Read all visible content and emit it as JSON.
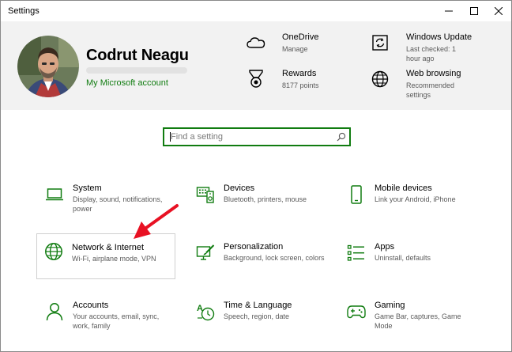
{
  "window": {
    "title": "Settings"
  },
  "header": {
    "user_name": "Codrut Neagu",
    "account_link": "My Microsoft account",
    "items": [
      {
        "title": "OneDrive",
        "subtitle": "Manage",
        "icon": "cloud-icon"
      },
      {
        "title": "Rewards",
        "subtitle": "8177 points",
        "icon": "medal-icon"
      },
      {
        "title": "Windows Update",
        "subtitle": "Last checked: 1 hour ago",
        "icon": "sync-icon"
      },
      {
        "title": "Web browsing",
        "subtitle": "Recommended settings",
        "icon": "globe-icon"
      }
    ]
  },
  "search": {
    "placeholder": "Find a setting",
    "value": ""
  },
  "categories": [
    {
      "title": "System",
      "subtitle": "Display, sound, notifications, power",
      "icon": "laptop-icon"
    },
    {
      "title": "Devices",
      "subtitle": "Bluetooth, printers, mouse",
      "icon": "keyboard-speaker-icon"
    },
    {
      "title": "Mobile devices",
      "subtitle": "Link your Android, iPhone",
      "icon": "phone-icon"
    },
    {
      "title": "Network & Internet",
      "subtitle": "Wi-Fi, airplane mode, VPN",
      "icon": "globe-icon"
    },
    {
      "title": "Personalization",
      "subtitle": "Background, lock screen, colors",
      "icon": "paint-icon"
    },
    {
      "title": "Apps",
      "subtitle": "Uninstall, defaults",
      "icon": "apps-list-icon"
    },
    {
      "title": "Accounts",
      "subtitle": "Your accounts, email, sync, work, family",
      "icon": "person-icon"
    },
    {
      "title": "Time & Language",
      "subtitle": "Speech, region, date",
      "icon": "time-language-icon"
    },
    {
      "title": "Gaming",
      "subtitle": "Game Bar, captures, Game Mode",
      "icon": "gamepad-icon"
    }
  ],
  "colors": {
    "accent": "#107c10",
    "annotation_arrow": "#e81123",
    "header_bg": "#f2f2f2"
  }
}
